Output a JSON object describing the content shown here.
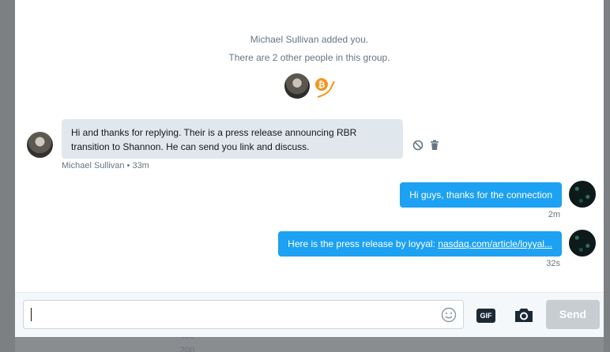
{
  "background": {
    "line_1": "400",
    "line_2": "200"
  },
  "system": {
    "added_text": "Michael Sullivan added you.",
    "group_text": "There are 2 other people in this group."
  },
  "messages": [
    {
      "direction": "incoming",
      "text": "Hi and thanks for replying. Their is a press release announcing RBR transition to Shannon. He can send you link and discuss.",
      "meta": "Michael Sullivan • 33m"
    },
    {
      "direction": "outgoing",
      "text": "Hi guys, thanks for the connection",
      "time": "2m"
    },
    {
      "direction": "outgoing",
      "text_prefix": "Here is the press release by loyyal: ",
      "link_text": "nasdaq.com/article/loyyal...",
      "time": "32s"
    }
  ],
  "composer": {
    "input_value": "",
    "gif_label": "GIF",
    "send_label": "Send"
  },
  "colors": {
    "accent": "#1da1f2",
    "incoming_bubble": "#e1e8ed",
    "send_disabled": "#c8cdd2"
  },
  "icons": [
    "bitcoin-icon",
    "block-icon",
    "trash-icon",
    "emoji-icon",
    "gif-icon",
    "camera-icon"
  ]
}
